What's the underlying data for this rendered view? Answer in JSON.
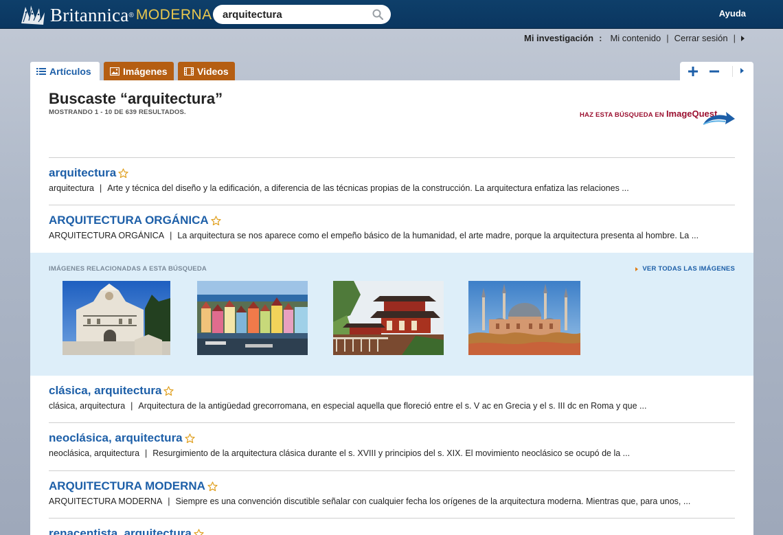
{
  "header": {
    "logo": {
      "name": "Britannica",
      "reg": "®",
      "product": "MODERNA"
    },
    "search": {
      "value": "arquitectura",
      "placeholder": ""
    },
    "help": "Ayuda"
  },
  "subnav": {
    "research": "Mi investigación",
    "colon": ":",
    "content": "Mi contenido",
    "divider": "|",
    "logout": "Cerrar sesión",
    "divider2": "|"
  },
  "tabs": [
    {
      "label": "Artículos",
      "active": true
    },
    {
      "label": "Imágenes",
      "active": false
    },
    {
      "label": "Videos",
      "active": false
    }
  ],
  "main": {
    "heading": "Buscaste “arquitectura”",
    "count": "MOSTRANDO 1 - 10 DE 639 RESULTADOS.",
    "imagequest": {
      "prefix": "HAZ ESTA BÚSQUEDA EN",
      "brand": "ImageQuest"
    }
  },
  "results": [
    {
      "title": "arquitectura",
      "source": "arquitectura",
      "bar": "|",
      "snippet": "Arte y técnica del diseño y la edificación, a diferencia de las técnicas propias de la construcción.  La arquitectura enfatiza las relaciones ..."
    },
    {
      "title": "ARQUITECTURA ORGÁNICA",
      "source": "ARQUITECTURA ORGÁNICA",
      "bar": "|",
      "snippet": "La arquitectura se nos aparece como el empeño básico de la humanidad, el arte madre, porque la arquitectura presenta al hombre. La ..."
    },
    {
      "title": "clásica, arquitectura",
      "source": "clásica, arquitectura",
      "bar": "|",
      "snippet": "Arquitectura de la antigüedad grecorromana, en especial aquella que floreció entre el s. V ac en Grecia y el s. III dc en Roma y que ..."
    },
    {
      "title": "neoclásica, arquitectura",
      "source": "neoclásica, arquitectura",
      "bar": "|",
      "snippet": "Resurgimiento de la arquitectura clásica durante el s. XVIII y principios del s. XIX.  El movimiento neoclásico se ocupó de la ..."
    },
    {
      "title": "ARQUITECTURA MODERNA",
      "source": "ARQUITECTURA MODERNA",
      "bar": "|",
      "snippet": "Siempre es una convención discutible señalar con cualquier fecha los orígenes de la arquitectura moderna. Mientras que, para unos, ..."
    },
    {
      "title": "renacentista, arquitectura",
      "source": "",
      "bar": "",
      "snippet": ""
    }
  ],
  "related": {
    "label": "IMÁGENES RELACIONADAS A ESTA BÚSQUEDA",
    "view_all": "VER TODAS LAS IMÁGENES"
  },
  "colors": {
    "header_bg": "#0a3660",
    "link_blue": "#1d5fa8",
    "tab_orange": "#b55e12",
    "imagequest_red": "#9b1030",
    "related_bg": "#ddeef9",
    "star": "#e0a020"
  }
}
